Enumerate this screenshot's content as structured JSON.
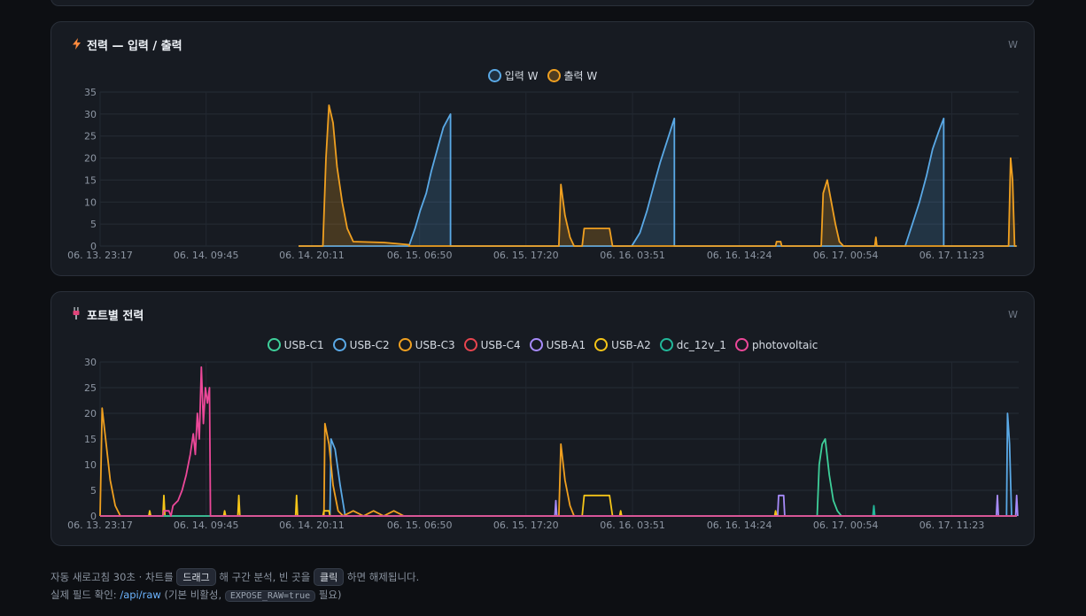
{
  "charts": [
    {
      "title": "전력 — 입력 / 출력",
      "unit": "W",
      "icon": "lightning-icon",
      "legend": [
        {
          "name": "입력 W",
          "color": "#5aa9e6",
          "fill": "rgba(90,169,230,0.18)"
        },
        {
          "name": "출력 W",
          "color": "#f0a020",
          "fill": "rgba(240,160,32,0.22)"
        }
      ]
    },
    {
      "title": "포트별 전력",
      "unit": "W",
      "icon": "plug-icon",
      "legend": [
        {
          "name": "USB-C1",
          "color": "#3ecf9a"
        },
        {
          "name": "USB-C2",
          "color": "#5aa9e6"
        },
        {
          "name": "USB-C3",
          "color": "#f0a020"
        },
        {
          "name": "USB-C4",
          "color": "#e8454f"
        },
        {
          "name": "USB-A1",
          "color": "#a78bfa"
        },
        {
          "name": "USB-A2",
          "color": "#f5c518"
        },
        {
          "name": "dc_12v_1",
          "color": "#22b89a"
        },
        {
          "name": "photovoltaic",
          "color": "#ec4899"
        }
      ]
    }
  ],
  "chart_data": [
    {
      "type": "area",
      "title": "전력 — 입력 / 출력",
      "ylabel": "W",
      "ylim": [
        0,
        35
      ],
      "yticks": [
        0,
        5,
        10,
        15,
        20,
        25,
        30,
        35
      ],
      "xlim": [
        0,
        90.7
      ],
      "x_unit": "hours since 06. 13. 23:17",
      "xtick_labels": [
        "06. 13. 23:17",
        "06. 14. 09:45",
        "06. 14. 20:11",
        "06. 15. 06:50",
        "06. 15. 17:20",
        "06. 16. 03:51",
        "06. 16. 14:24",
        "06. 17. 00:54",
        "06. 17. 11:23"
      ],
      "xtick_pos": [
        0,
        10.47,
        20.9,
        31.55,
        42.05,
        52.57,
        63.12,
        73.62,
        84.1
      ],
      "grid": true,
      "legend_position": "top-center",
      "series": [
        {
          "name": "입력 W",
          "points": [
            [
              19.6,
              0
            ],
            [
              30.5,
              0
            ],
            [
              31.1,
              4
            ],
            [
              31.6,
              8
            ],
            [
              32.2,
              12
            ],
            [
              32.7,
              17
            ],
            [
              33.3,
              22
            ],
            [
              33.9,
              27
            ],
            [
              34.6,
              30
            ],
            [
              34.6,
              0
            ],
            [
              52.5,
              0
            ],
            [
              53.3,
              3
            ],
            [
              54.0,
              8
            ],
            [
              54.7,
              14
            ],
            [
              55.3,
              19
            ],
            [
              56.0,
              24
            ],
            [
              56.7,
              29
            ],
            [
              56.7,
              0
            ],
            [
              79.5,
              0
            ],
            [
              80.2,
              5
            ],
            [
              80.9,
              10
            ],
            [
              81.6,
              16
            ],
            [
              82.2,
              22
            ],
            [
              82.8,
              26
            ],
            [
              83.3,
              29
            ],
            [
              83.3,
              0
            ],
            [
              90.5,
              0
            ]
          ]
        },
        {
          "name": "출력 W",
          "points": [
            [
              19.6,
              0
            ],
            [
              22.0,
              0
            ],
            [
              22.3,
              20
            ],
            [
              22.6,
              32
            ],
            [
              23.0,
              28
            ],
            [
              23.4,
              18
            ],
            [
              23.9,
              10
            ],
            [
              24.4,
              4
            ],
            [
              25.0,
              1
            ],
            [
              28.0,
              0.8
            ],
            [
              30.5,
              0.3
            ],
            [
              30.5,
              0
            ],
            [
              45.3,
              0
            ],
            [
              45.5,
              14
            ],
            [
              45.9,
              7
            ],
            [
              46.4,
              2
            ],
            [
              46.8,
              0
            ],
            [
              47.6,
              0
            ],
            [
              47.8,
              4
            ],
            [
              50.3,
              4
            ],
            [
              50.6,
              0
            ],
            [
              66.7,
              0
            ],
            [
              66.8,
              1
            ],
            [
              67.2,
              1
            ],
            [
              67.3,
              0
            ],
            [
              71.2,
              0
            ],
            [
              71.4,
              12
            ],
            [
              71.8,
              15
            ],
            [
              72.2,
              10
            ],
            [
              72.6,
              5
            ],
            [
              73.0,
              1
            ],
            [
              73.4,
              0
            ],
            [
              76.5,
              0
            ],
            [
              76.6,
              2
            ],
            [
              76.7,
              0
            ],
            [
              89.7,
              0
            ],
            [
              89.9,
              20
            ],
            [
              90.1,
              15
            ],
            [
              90.3,
              0
            ],
            [
              90.5,
              0
            ]
          ]
        }
      ]
    },
    {
      "type": "line",
      "title": "포트별 전력",
      "ylabel": "W",
      "ylim": [
        0,
        30
      ],
      "yticks": [
        0,
        5,
        10,
        15,
        20,
        25,
        30
      ],
      "xlim": [
        0,
        90.7
      ],
      "x_unit": "hours since 06. 13. 23:17",
      "xtick_labels": [
        "06. 13. 23:17",
        "06. 14. 09:45",
        "06. 14. 20:11",
        "06. 15. 06:50",
        "06. 15. 17:20",
        "06. 16. 03:51",
        "06. 16. 14:24",
        "06. 17. 00:54",
        "06. 17. 11:23"
      ],
      "xtick_pos": [
        0,
        10.47,
        20.9,
        31.55,
        42.05,
        52.57,
        63.12,
        73.62,
        84.1
      ],
      "grid": true,
      "legend_position": "top-center",
      "series": [
        {
          "name": "USB-C1",
          "points": [
            [
              0,
              0
            ],
            [
              70.8,
              0
            ],
            [
              71.0,
              10
            ],
            [
              71.3,
              14
            ],
            [
              71.6,
              15
            ],
            [
              72.0,
              8
            ],
            [
              72.4,
              3
            ],
            [
              72.8,
              1
            ],
            [
              73.2,
              0
            ],
            [
              90.5,
              0
            ]
          ]
        },
        {
          "name": "USB-C2",
          "points": [
            [
              0,
              0
            ],
            [
              22.7,
              0
            ],
            [
              22.8,
              15
            ],
            [
              23.2,
              13
            ],
            [
              23.7,
              6
            ],
            [
              24.2,
              0
            ],
            [
              89.5,
              0
            ],
            [
              89.6,
              20
            ],
            [
              89.8,
              14
            ],
            [
              90.0,
              0
            ],
            [
              90.5,
              0
            ]
          ]
        },
        {
          "name": "USB-C3",
          "points": [
            [
              0,
              0
            ],
            [
              0.2,
              21
            ],
            [
              0.6,
              14
            ],
            [
              1.0,
              7
            ],
            [
              1.5,
              2
            ],
            [
              2.0,
              0
            ],
            [
              22.1,
              0
            ],
            [
              22.2,
              18
            ],
            [
              22.6,
              14
            ],
            [
              23.0,
              6
            ],
            [
              23.5,
              1
            ],
            [
              24.0,
              0
            ],
            [
              25.0,
              1
            ],
            [
              26.0,
              0
            ],
            [
              27.0,
              1
            ],
            [
              28.0,
              0
            ],
            [
              29.0,
              1
            ],
            [
              30.0,
              0
            ],
            [
              45.3,
              0
            ],
            [
              45.5,
              14
            ],
            [
              45.9,
              7
            ],
            [
              46.4,
              2
            ],
            [
              46.8,
              0
            ],
            [
              90.5,
              0
            ]
          ]
        },
        {
          "name": "USB-C4",
          "points": [
            [
              0,
              0
            ],
            [
              90.5,
              0
            ]
          ]
        },
        {
          "name": "USB-A1",
          "points": [
            [
              0,
              0
            ],
            [
              44.9,
              0
            ],
            [
              45.0,
              3
            ],
            [
              45.1,
              0
            ],
            [
              66.9,
              0
            ],
            [
              67.0,
              4
            ],
            [
              67.5,
              4
            ],
            [
              67.6,
              0
            ],
            [
              88.5,
              0
            ],
            [
              88.6,
              4
            ],
            [
              88.7,
              0
            ],
            [
              90.4,
              0
            ],
            [
              90.5,
              4
            ],
            [
              90.6,
              0
            ]
          ]
        },
        {
          "name": "USB-A2",
          "points": [
            [
              0,
              0
            ],
            [
              4.8,
              0
            ],
            [
              4.9,
              1
            ],
            [
              5.0,
              0
            ],
            [
              6.2,
              0
            ],
            [
              6.3,
              4
            ],
            [
              6.4,
              0
            ],
            [
              12.2,
              0
            ],
            [
              12.3,
              1
            ],
            [
              12.4,
              0
            ],
            [
              13.6,
              0
            ],
            [
              13.7,
              4
            ],
            [
              13.8,
              0
            ],
            [
              19.3,
              0
            ],
            [
              19.4,
              4
            ],
            [
              19.5,
              0
            ],
            [
              22.0,
              0
            ],
            [
              22.1,
              1
            ],
            [
              22.6,
              1
            ],
            [
              22.7,
              0
            ],
            [
              47.6,
              0
            ],
            [
              47.8,
              4
            ],
            [
              50.3,
              4
            ],
            [
              50.6,
              0
            ],
            [
              51.3,
              0
            ],
            [
              51.4,
              1
            ],
            [
              51.5,
              0
            ],
            [
              66.6,
              0
            ],
            [
              66.7,
              1
            ],
            [
              66.8,
              0
            ],
            [
              90.5,
              0
            ]
          ]
        },
        {
          "name": "dc_12v_1",
          "points": [
            [
              0,
              0
            ],
            [
              76.3,
              0
            ],
            [
              76.4,
              2
            ],
            [
              76.5,
              0
            ],
            [
              90.5,
              0
            ]
          ]
        },
        {
          "name": "photovoltaic",
          "points": [
            [
              0,
              0
            ],
            [
              6.2,
              0
            ],
            [
              6.3,
              1
            ],
            [
              6.8,
              1
            ],
            [
              7.0,
              0
            ],
            [
              7.2,
              2
            ],
            [
              7.7,
              3
            ],
            [
              8.1,
              5
            ],
            [
              8.5,
              8
            ],
            [
              8.9,
              12
            ],
            [
              9.2,
              16
            ],
            [
              9.4,
              12
            ],
            [
              9.6,
              20
            ],
            [
              9.8,
              15
            ],
            [
              10.0,
              29
            ],
            [
              10.2,
              18
            ],
            [
              10.4,
              25
            ],
            [
              10.6,
              22
            ],
            [
              10.8,
              25
            ],
            [
              10.9,
              0
            ],
            [
              90.5,
              0
            ]
          ]
        }
      ]
    }
  ],
  "footer": {
    "line1_a": "자동 새로고침 30초 · 차트를",
    "drag": "드래그",
    "line1_b": "해 구간 분석, 빈 곳을",
    "click": "클릭",
    "line1_c": "하면 해제됩니다.",
    "line2_a": "실제 필드 확인:",
    "api": "/api/raw",
    "line2_b": "(기본 비활성,",
    "env": "EXPOSE_RAW=true",
    "line2_c": "필요)"
  }
}
